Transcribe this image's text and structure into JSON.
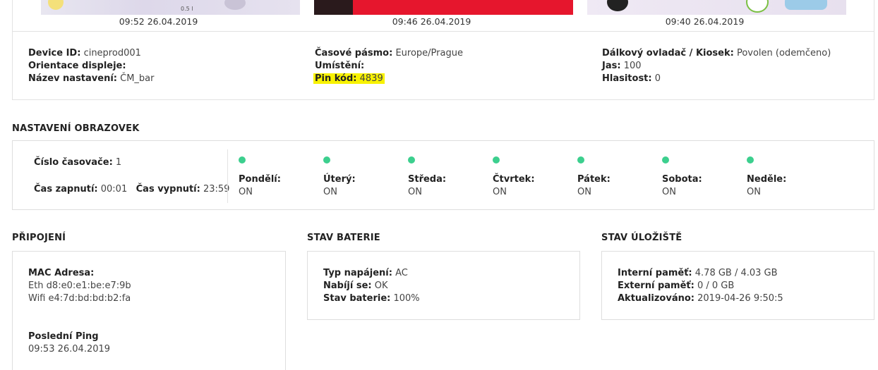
{
  "screenshots": [
    {
      "time": "09:52 26.04.2019",
      "caption": "0.5 l"
    },
    {
      "time": "09:46 26.04.2019"
    },
    {
      "time": "09:40 26.04.2019"
    }
  ],
  "device": {
    "col1": [
      {
        "label": "Device ID:",
        "value": "cineprod001"
      },
      {
        "label": "Orientace displeje:",
        "value": ""
      },
      {
        "label": "Název nastavení:",
        "value": "ČM_bar"
      }
    ],
    "col2": [
      {
        "label": "Časové pásmo:",
        "value": "Europe/Prague"
      },
      {
        "label": "Umístění:",
        "value": ""
      },
      {
        "label": "Pin kód:",
        "value": "4839"
      }
    ],
    "col3": [
      {
        "label": "Dálkový ovladač / Kiosek:",
        "value": "Povolen (odemčeno)"
      },
      {
        "label": "Jas:",
        "value": "100"
      },
      {
        "label": "Hlasitost:",
        "value": "0"
      }
    ]
  },
  "screens": {
    "title": "NASTAVENÍ OBRAZOVEK",
    "timer_number_label": "Číslo časovače:",
    "timer_number": "1",
    "on_label": "Čas zapnutí:",
    "on_value": "00:01",
    "off_label": "Čas vypnutí:",
    "off_value": "23:59",
    "days": [
      {
        "name": "Pondělí:",
        "state": "ON"
      },
      {
        "name": "Úterý:",
        "state": "ON"
      },
      {
        "name": "Středa:",
        "state": "ON"
      },
      {
        "name": "Čtvrtek:",
        "state": "ON"
      },
      {
        "name": "Pátek:",
        "state": "ON"
      },
      {
        "name": "Sobota:",
        "state": "ON"
      },
      {
        "name": "Neděle:",
        "state": "ON"
      }
    ],
    "dot_color": "#3ccf8e"
  },
  "connection": {
    "title": "PŘIPOJENÍ",
    "mac_label": "MAC Adresa:",
    "eth": "Eth d8:e0:e1:be:e7:9b",
    "wifi": "Wifi e4:7d:bd:bd:b2:fa",
    "ping_label": "Poslední Ping",
    "ping_value": "09:53 26.04.2019"
  },
  "battery": {
    "title": "STAV BATERIE",
    "rows": [
      {
        "label": "Typ napájení:",
        "value": "AC"
      },
      {
        "label": "Nabíjí se:",
        "value": "OK"
      },
      {
        "label": "Stav baterie:",
        "value": "100%"
      }
    ]
  },
  "storage": {
    "title": "STAV ÚLOŽIŠTĚ",
    "rows": [
      {
        "label": "Interní paměť:",
        "value": "4.78 GB / 4.03 GB"
      },
      {
        "label": "Externí paměť:",
        "value": "0 / 0 GB"
      },
      {
        "label": "Aktualizováno:",
        "value": "2019-04-26 9:50:5"
      }
    ]
  }
}
